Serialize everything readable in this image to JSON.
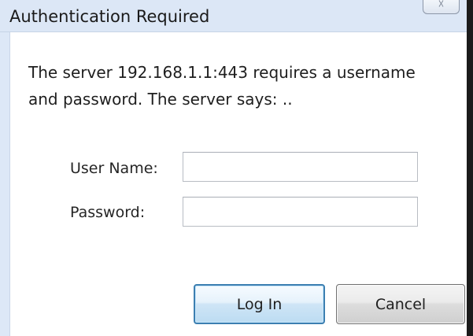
{
  "dialog": {
    "title": "Authentication Required",
    "close_label": "☓",
    "message_line1": "The server 192.168.1.1:443 requires a username",
    "message_line2": "and password. The server says: ..",
    "username_label": "User Name:",
    "password_label": "Password:",
    "username_value": "",
    "password_value": "",
    "login_label": "Log In",
    "cancel_label": "Cancel"
  }
}
